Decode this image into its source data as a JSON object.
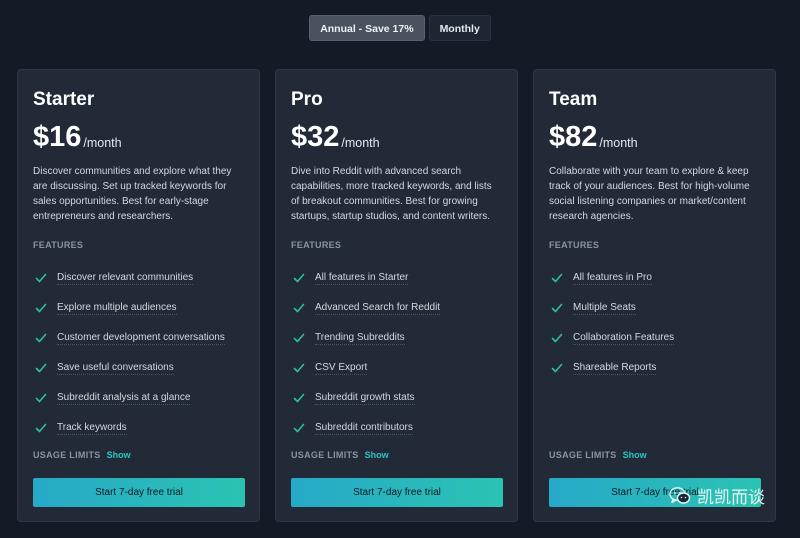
{
  "billing_toggle": {
    "annual_label": "Annual - Save 17%",
    "monthly_label": "Monthly",
    "selected": "annual"
  },
  "colors": {
    "background": "#141a26",
    "card": "#222a38",
    "accent": "#2cc5c0",
    "check": "#2bbfa0"
  },
  "plans": [
    {
      "name": "Starter",
      "price": "$16",
      "period": "/month",
      "description": "Discover communities and explore what they are discussing. Set up tracked keywords for sales opportunities. Best for early-stage entrepreneurs and researchers.",
      "features_label": "FEATURES",
      "features": [
        "Discover relevant communities",
        "Explore multiple audiences",
        "Customer development conversations",
        "Save useful conversations",
        "Subreddit analysis at a glance",
        "Track keywords"
      ],
      "usage_label": "USAGE LIMITS",
      "show_label": "Show",
      "cta_label": "Start 7-day free trial"
    },
    {
      "name": "Pro",
      "price": "$32",
      "period": "/month",
      "description": "Dive into Reddit with advanced search capabilities, more tracked keywords, and lists of breakout communities. Best for growing startups, startup studios, and content writers.",
      "features_label": "FEATURES",
      "features": [
        "All features in Starter",
        "Advanced Search for Reddit",
        "Trending Subreddits",
        "CSV Export",
        "Subreddit growth stats",
        "Subreddit contributors"
      ],
      "usage_label": "USAGE LIMITS",
      "show_label": "Show",
      "cta_label": "Start 7-day free trial"
    },
    {
      "name": "Team",
      "price": "$82",
      "period": "/month",
      "description": "Collaborate with your team to explore & keep track of your audiences. Best for high-volume social listening companies or market/content research agencies.",
      "features_label": "FEATURES",
      "features": [
        "All features in Pro",
        "Multiple Seats",
        "Collaboration Features",
        "Shareable Reports"
      ],
      "usage_label": "USAGE LIMITS",
      "show_label": "Show",
      "cta_label": "Start 7-day free trial"
    }
  ],
  "watermark": {
    "icon": "wechat-icon",
    "text": "凯凯而谈"
  }
}
